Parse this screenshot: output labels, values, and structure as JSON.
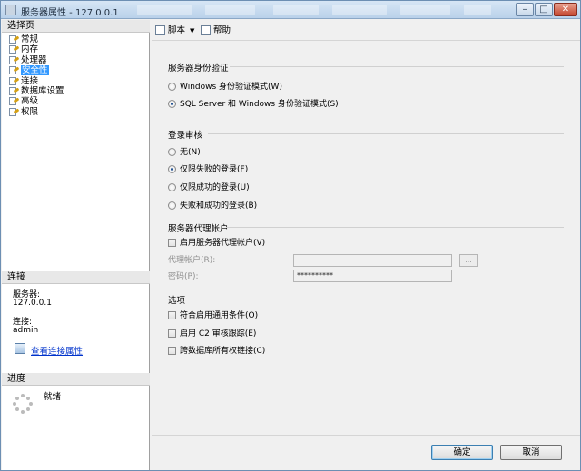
{
  "window": {
    "title": "服务器属性 - 127.0.0.1"
  },
  "left": {
    "select_page_header": "选择页",
    "pages": [
      {
        "label": "常规",
        "selected": false
      },
      {
        "label": "内存",
        "selected": false
      },
      {
        "label": "处理器",
        "selected": false
      },
      {
        "label": "安全性",
        "selected": true
      },
      {
        "label": "连接",
        "selected": false
      },
      {
        "label": "数据库设置",
        "selected": false
      },
      {
        "label": "高级",
        "selected": false
      },
      {
        "label": "权限",
        "selected": false
      }
    ],
    "connection_header": "连接",
    "server_label": "服务器:",
    "server_value": "127.0.0.1",
    "connection_label": "连接:",
    "connection_value": "admin",
    "view_connection_link": "查看连接属性",
    "progress_header": "进度",
    "progress_status": "就绪"
  },
  "toolbar": {
    "script_label": "脚本",
    "help_label": "帮助"
  },
  "auth": {
    "title": "服务器身份验证",
    "windows_mode": "Windows 身份验证模式(W)",
    "sql_mode": "SQL Server 和 Windows 身份验证模式(S)",
    "selected": "sql"
  },
  "audit": {
    "title": "登录审核",
    "options": [
      "无(N)",
      "仅限失败的登录(F)",
      "仅限成功的登录(U)",
      "失败和成功的登录(B)"
    ],
    "selected_index": 1
  },
  "proxy": {
    "title": "服务器代理帐户",
    "enable_label": "启用服务器代理帐户(V)",
    "account_label": "代理帐户(R):",
    "account_value": "",
    "password_label": "密码(P):",
    "password_value": "**********",
    "browse_label": "..."
  },
  "options": {
    "title": "选项",
    "items": [
      "符合启用通用条件(O)",
      "启用 C2 审核跟踪(E)",
      "跨数据库所有权链接(C)"
    ]
  },
  "buttons": {
    "ok": "确定",
    "cancel": "取消"
  }
}
